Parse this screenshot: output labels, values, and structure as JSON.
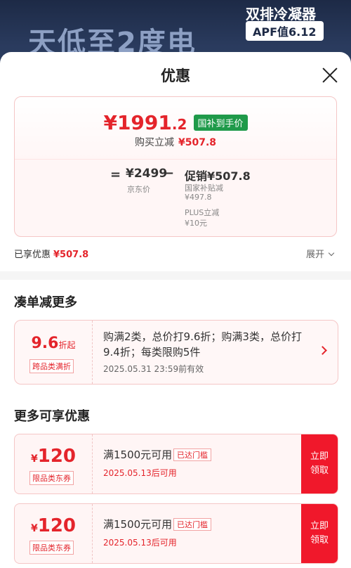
{
  "banner": {
    "headline": "天低至2度电",
    "product": "双排冷凝器",
    "apf": "APF值6.12"
  },
  "sheet": {
    "title": "优惠",
    "price": {
      "final_int": "¥1991",
      "final_dec": ".2",
      "final_tag": "国补到手价",
      "buy_label": "购买立减",
      "buy_value": "¥507.8",
      "orig_price": "¥2499",
      "orig_label": "京东价",
      "promo_label": "促销",
      "promo_value": "¥507.8",
      "detail": [
        {
          "label": "国家补贴减",
          "value": "¥497.8"
        },
        {
          "label": "PLUS立减",
          "value": "¥10元"
        }
      ]
    },
    "enjoyed_label": "已享优惠",
    "enjoyed_value": "¥507.8",
    "expand_label": "展开"
  },
  "combine": {
    "title": "凑单减更多",
    "value": "9.6",
    "unit": "折起",
    "sub": "跨品类满折",
    "desc": "购满2类，总价打9.6折；购满3类，总价打9.4折；每类限购5件",
    "date": "2025.05.31  23:59前有效"
  },
  "more": {
    "title": "更多可享优惠",
    "coupons": [
      {
        "currency": "¥",
        "amount": "120",
        "type": "限品类东券",
        "condition": "满1500元可用",
        "badge": "已达门槛",
        "date": "2025.05.13后可用",
        "button": "立即领取"
      },
      {
        "currency": "¥",
        "amount": "120",
        "type": "限品类东券",
        "condition": "满1500元可用",
        "badge": "已达门槛",
        "date": "2025.05.13后可用",
        "button": "立即领取"
      }
    ]
  },
  "colors": {
    "accent": "#e4242b",
    "tag_green": "#1f9a4a",
    "button_red": "#f0182b"
  }
}
